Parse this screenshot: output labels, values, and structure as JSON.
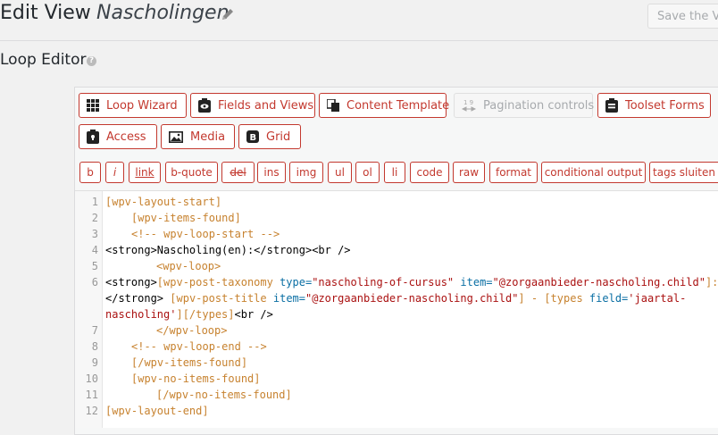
{
  "header": {
    "title": "Edit View",
    "view_name": "Nascholingen",
    "save_label": "Save the Vi"
  },
  "section": {
    "title": "Loop Editor"
  },
  "toolbar": {
    "buttons": [
      {
        "label": "Loop Wizard",
        "icon": "grid-icon"
      },
      {
        "label": "Fields and Views",
        "icon": "toolset-views-icon"
      },
      {
        "label": "Content Template",
        "icon": "copy-icon"
      },
      {
        "label": "Pagination controls",
        "icon": "pagination-icon",
        "disabled": true
      },
      {
        "label": "Toolset Forms",
        "icon": "toolset-forms-icon"
      },
      {
        "label": "Access",
        "icon": "lock-icon"
      },
      {
        "label": "Media",
        "icon": "image-icon"
      },
      {
        "label": "Grid",
        "icon": "bootstrap-icon"
      }
    ],
    "pagination_icon_text": "1 9"
  },
  "quicktags": [
    "b",
    "i",
    "link",
    "b-quote",
    "del",
    "ins",
    "img",
    "ul",
    "ol",
    "li",
    "code",
    "raw",
    "format",
    "conditional output",
    "tags sluiten"
  ],
  "code": {
    "line_numbers": [
      "1",
      "2",
      "3",
      "4",
      "5",
      "6",
      "7",
      "8",
      "9",
      "10",
      "11",
      "12"
    ],
    "l1": "[wpv-layout-start]",
    "l2": "[wpv-items-found]",
    "l3": "<!-- wpv-loop-start -->",
    "l4a": "<strong>Nascholing(en):</strong><br />",
    "l5": "<wpv-loop>",
    "l6a_open": "<strong>",
    "l6a_sc": "[wpv-post-taxonomy",
    "l6a_type_attr": "type=",
    "l6a_type_val": "\"nascholing-of-cursus\"",
    "l6a_item_attr": "item=",
    "l6a_item_val": "\"@zorgaanbieder-nascholing.child\"",
    "l6a_end": "]:",
    "l6b_close": "</strong>",
    "l6b_sc": "[wpv-post-title",
    "l6b_item_attr": "item=",
    "l6b_item_val": "\"@zorgaanbieder-nascholing.child\"",
    "l6b_sep": "] - ",
    "l6b_types": "[types",
    "l6b_field_attr": "field=",
    "l6b_field_val": "'jaartal-",
    "l6c_field_val": "nascholing'",
    "l6c_end": "][/types]",
    "l6c_br": "<br />",
    "l7": "</wpv-loop>",
    "l8": "<!-- wpv-loop-end -->",
    "l9": "[/wpv-items-found]",
    "l10": "[wpv-no-items-found]",
    "l11": "[/wpv-no-items-found]",
    "l12": "[wpv-layout-end]"
  }
}
